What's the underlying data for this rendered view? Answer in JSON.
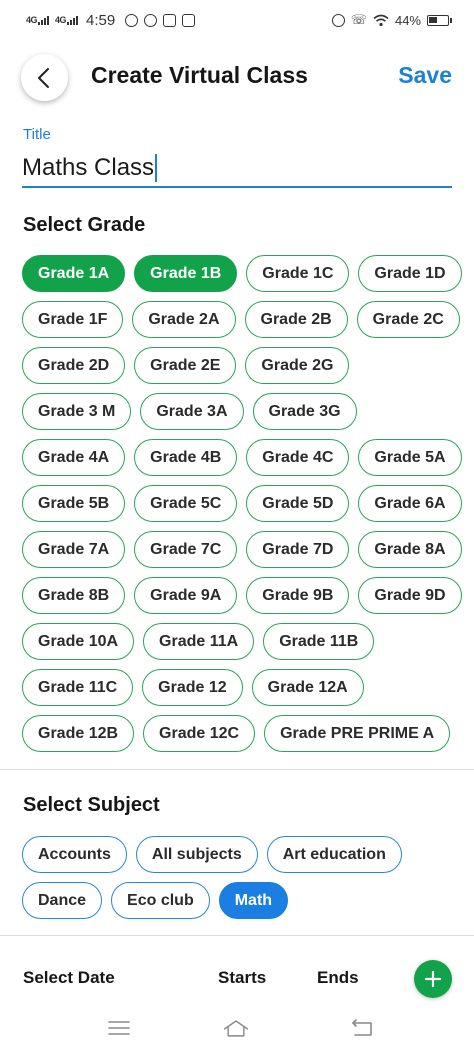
{
  "status_bar": {
    "network_1": "4G",
    "network_2": "4G",
    "time": "4:59",
    "battery": "44%"
  },
  "app_bar": {
    "title": "Create Virtual Class",
    "save_label": "Save"
  },
  "title_field": {
    "label": "Title",
    "value": "Maths Class"
  },
  "grade_section": {
    "heading": "Select Grade",
    "grades": [
      {
        "label": "Grade 1A",
        "selected": true
      },
      {
        "label": "Grade 1B",
        "selected": true
      },
      {
        "label": "Grade 1C",
        "selected": false
      },
      {
        "label": "Grade 1D",
        "selected": false
      },
      {
        "label": "Grade 1F",
        "selected": false
      },
      {
        "label": "Grade 2A",
        "selected": false
      },
      {
        "label": "Grade 2B",
        "selected": false
      },
      {
        "label": "Grade 2C",
        "selected": false
      },
      {
        "label": "Grade 2D",
        "selected": false
      },
      {
        "label": "Grade 2E",
        "selected": false
      },
      {
        "label": "Grade 2G",
        "selected": false
      },
      {
        "label": "Grade 3 M",
        "selected": false
      },
      {
        "label": "Grade 3A",
        "selected": false
      },
      {
        "label": "Grade 3G",
        "selected": false
      },
      {
        "label": "Grade 4A",
        "selected": false
      },
      {
        "label": "Grade 4B",
        "selected": false
      },
      {
        "label": "Grade 4C",
        "selected": false
      },
      {
        "label": "Grade 5A",
        "selected": false
      },
      {
        "label": "Grade 5B",
        "selected": false
      },
      {
        "label": "Grade 5C",
        "selected": false
      },
      {
        "label": "Grade 5D",
        "selected": false
      },
      {
        "label": "Grade 6A",
        "selected": false
      },
      {
        "label": "Grade 7A",
        "selected": false
      },
      {
        "label": "Grade 7C",
        "selected": false
      },
      {
        "label": "Grade 7D",
        "selected": false
      },
      {
        "label": "Grade 8A",
        "selected": false
      },
      {
        "label": "Grade 8B",
        "selected": false
      },
      {
        "label": "Grade 9A",
        "selected": false
      },
      {
        "label": "Grade 9B",
        "selected": false
      },
      {
        "label": "Grade 9D",
        "selected": false
      },
      {
        "label": "Grade 10A",
        "selected": false
      },
      {
        "label": "Grade 11A",
        "selected": false
      },
      {
        "label": "Grade 11B",
        "selected": false
      },
      {
        "label": "Grade 11C",
        "selected": false
      },
      {
        "label": "Grade 12",
        "selected": false
      },
      {
        "label": "Grade 12A",
        "selected": false
      },
      {
        "label": "Grade 12B",
        "selected": false
      },
      {
        "label": "Grade 12C",
        "selected": false
      },
      {
        "label": "Grade PRE PRIME A",
        "selected": false
      }
    ]
  },
  "subject_section": {
    "heading": "Select Subject",
    "subjects": [
      {
        "label": "Accounts",
        "selected": false
      },
      {
        "label": "All subjects",
        "selected": false
      },
      {
        "label": "Art education",
        "selected": false
      },
      {
        "label": "Dance",
        "selected": false
      },
      {
        "label": "Eco club",
        "selected": false
      },
      {
        "label": "Math",
        "selected": true
      }
    ]
  },
  "date_section": {
    "label": "Select Date",
    "starts_label": "Starts",
    "ends_label": "Ends"
  },
  "colors": {
    "accent_blue": "#1a82d6",
    "grade_green": "#12a34a",
    "chip_border_green": "#2aa556",
    "subject_blue": "#1a7fe0"
  },
  "icons": {
    "back": "chevron-left-icon",
    "add": "plus-icon",
    "nav_menu": "menu-icon",
    "nav_home": "home-icon",
    "nav_back": "back-arrow-icon"
  }
}
